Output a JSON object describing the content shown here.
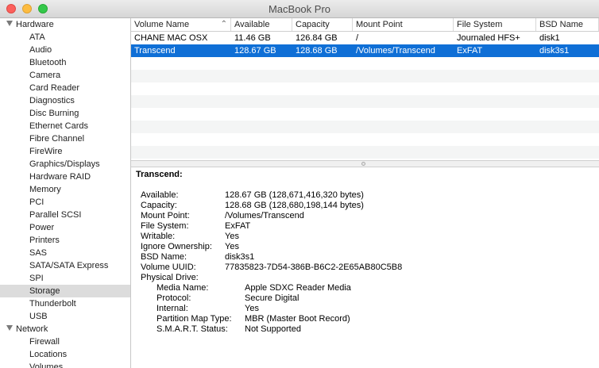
{
  "window": {
    "title": "MacBook Pro"
  },
  "sidebar": {
    "groups": [
      {
        "label": "Hardware",
        "items": [
          "ATA",
          "Audio",
          "Bluetooth",
          "Camera",
          "Card Reader",
          "Diagnostics",
          "Disc Burning",
          "Ethernet Cards",
          "Fibre Channel",
          "FireWire",
          "Graphics/Displays",
          "Hardware RAID",
          "Memory",
          "PCI",
          "Parallel SCSI",
          "Power",
          "Printers",
          "SAS",
          "SATA/SATA Express",
          "SPI",
          "Storage",
          "Thunderbolt",
          "USB"
        ]
      },
      {
        "label": "Network",
        "items": [
          "Firewall",
          "Locations",
          "Volumes"
        ]
      }
    ],
    "selected": "Storage"
  },
  "table": {
    "columns": [
      "Volume Name",
      "Available",
      "Capacity",
      "Mount Point",
      "File System",
      "BSD Name"
    ],
    "rows": [
      [
        "CHANE MAC OSX",
        "11.46 GB",
        "126.84 GB",
        "/",
        "Journaled HFS+",
        "disk1"
      ],
      [
        "Transcend",
        "128.67 GB",
        "128.68 GB",
        "/Volumes/Transcend",
        "ExFAT",
        "disk3s1"
      ]
    ],
    "selected_row": 1
  },
  "detail": {
    "title": "Transcend:",
    "fields": [
      [
        "Available:",
        "128.67 GB (128,671,416,320 bytes)"
      ],
      [
        "Capacity:",
        "128.68 GB (128,680,198,144 bytes)"
      ],
      [
        "Mount Point:",
        "/Volumes/Transcend"
      ],
      [
        "File System:",
        "ExFAT"
      ],
      [
        "Writable:",
        "Yes"
      ],
      [
        "Ignore Ownership:",
        "Yes"
      ],
      [
        "BSD Name:",
        "disk3s1"
      ],
      [
        "Volume UUID:",
        "77835823-7D54-386B-B6C2-2E65AB80C5B8"
      ],
      [
        "Physical Drive:",
        ""
      ]
    ],
    "physical_drive": [
      [
        "Media Name:",
        "Apple SDXC Reader Media"
      ],
      [
        "Protocol:",
        "Secure Digital"
      ],
      [
        "Internal:",
        "Yes"
      ],
      [
        "Partition Map Type:",
        "MBR (Master Boot Record)"
      ],
      [
        "S.M.A.R.T. Status:",
        "Not Supported"
      ]
    ]
  },
  "colors": {
    "selection_blue": "#0f6fd6",
    "sidebar_selection": "#dcdcdc"
  },
  "icons": {
    "sort": "chevron-up-icon",
    "group_toggle": "disclosure-triangle-icon"
  }
}
